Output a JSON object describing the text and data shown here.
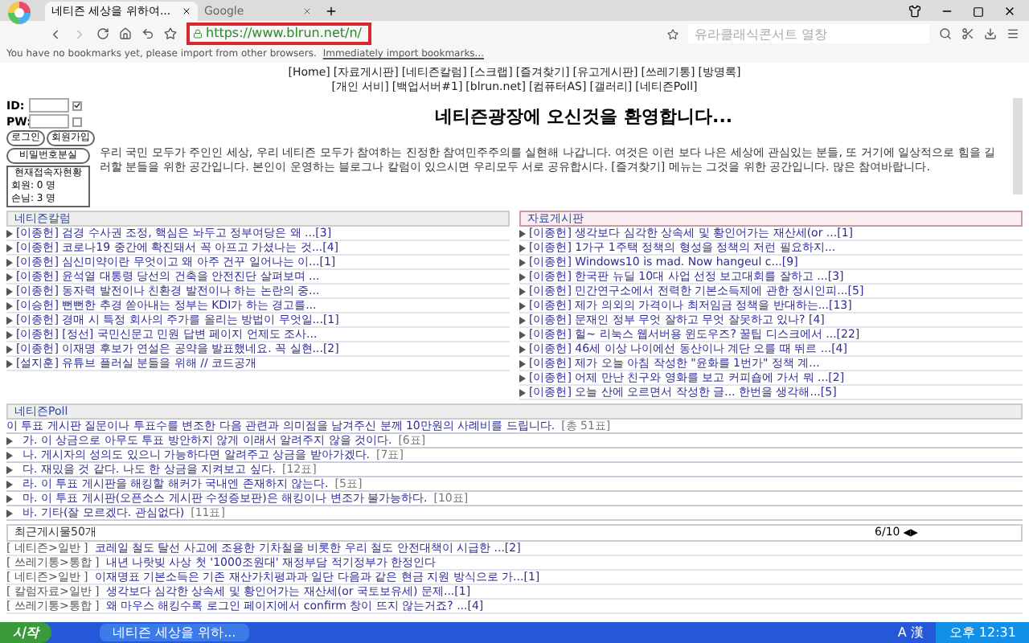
{
  "browser": {
    "tabs": [
      {
        "label": "네티즌 세상을 위하여...",
        "selected": true
      },
      {
        "label": "Google",
        "selected": false
      }
    ],
    "url": "https://www.blrun.net/n/",
    "search_placeholder": "유라클래식콘서트 열창",
    "bookmark_notice": "You have no bookmarks yet, please import from other browsers.",
    "bookmark_link": "Immediately import bookmarks..."
  },
  "nav": {
    "row_1": [
      "[Home]",
      "[자료게시판]",
      "[네티즌칼럼]",
      "[스크랩]",
      "[즐겨찾기]",
      "[유고게시판]",
      "[쓰레기통]",
      "[방명록]"
    ],
    "row_2": [
      "[개인 서비]",
      "[백업서버#1]",
      "[blrun.net]",
      "[컴퓨터AS]",
      "[갤러리]",
      "[네티즌Poll]"
    ]
  },
  "login": {
    "id_label": "ID:",
    "pw_label": "PW:",
    "id_remember": true,
    "pw_remember": false,
    "buttons": [
      "로그인",
      "회원가입"
    ],
    "lost_password": "비밀번호분실",
    "online": {
      "title": "현재접속자현황",
      "members": "회원:  0 명",
      "guests": "손님:  3 명"
    }
  },
  "welcome": {
    "title": "네티즌광장에 오신것을 환영합니다...",
    "text": "우리 국민 모두가 주인인 세상, 우리 네티즌 모두가 참여하는 진정한 참여민주주의를 실현해 나갑니다. 여것은 이런 보다 나은 세상에 관심있는 분들, 또 거기에 일상적으로 힘을 길러할 분들을 위한 공간입니다. 본인이 운영하는 블로그나 칼럼이 있으시면 우리모두 서로 공유합시다. [즐겨찾기] 메뉴는 그것을 위한 공간입니다. 많은 참여바랍니다."
  },
  "columns": [
    {
      "title": "네티즌칼럼",
      "items": [
        "[이종헌] 검경 수사권 조정, 핵심은 놔두고 정부여당은 왜 ...[3]",
        "[이종헌] 코로나19 중간에 확진돼서 꼭 아프고 가셨나는 것...[4]",
        "[이종헌] 심신미약이란 무엇이고 왜 아주 건꾸 일어나는 이...[1]",
        "[이종헌] 윤석열 대통령 당선의 건축을 안전진단 살펴보며 ...",
        "[이종헌] 동자력 발전이나 친환경 발전이나 하는 논란의 중...",
        "[이승헌] 뻔뻔한 추경 쏟아내는 정부는 KDI가 하는 경고를...",
        "[이종헌] 경매 시 특정 회사의 주가를 올리는 방법이 무엇일...[1]",
        "[이종헌] [정선] 국민신문고 민원 답변 페이지 언제도 조사...",
        "[이종헌] 이재명 후보가 연설은 공약을 발표했네요. 꼭 실현...[2]",
        "[설지훈] 유튜브 플러실 분들을 위해 // 코드공개"
      ]
    },
    {
      "title": "자료게시판",
      "items": [
        "[이종헌] 생각보다 심각한 상속세 및 황인어가는 재산세(or ...[1]",
        "[이종헌] 1가구 1주택 정책의 형성을 정책의 저런 필요하지...",
        "[이종헌] Windows10 is mad. Now hangeul c...[9]",
        "[이종헌] 한국판 뉴딜 10대 사업 선정 보고대회를 잘하고 ...[3]",
        "[이종헌] 민간연구소에서 전력한 기본소득제에 관한 정시인피...[5]",
        "[이종헌] 제가 의외의 가격이나 최저임금 정책을 반대하는...[13]",
        "[이종헌] 문재인 정부 무엇 잘하고 무엇 잘못하고 있나? [4]",
        "[이종헌] 헐~ 리눅스 웹서버용 윈도우즈? 꿀팁 디스크에서 ...[22]",
        "[이종헌] 46세 이상 나이에선 동산이나 계단 오를 때 뛰르 ...[4]",
        "[이종헌] 제가 오늘 아침 작성한 \"윤화를 1번가\" 정책 계...",
        "[이종헌] 어제 만난 친구와 영화를 보고 커피숍에 가서 뭐 ...[2]",
        "[이종헌] 오늘 산에 오르면서 작성한 글... 한번을 생각해...[5]"
      ]
    }
  ],
  "poll": {
    "title": "네티즌Poll",
    "question": "이 투표 게시판 질문이나 투표수를 변조한 다음 관련과 의미점을 남겨주신 분께 10만원의 사례비를 드립니다.",
    "total": "[총 51표]",
    "options": [
      {
        "text": "가. 이 상금으로 아무도 투표 방안하지 않게 이래서 알려주지 않을 것이다.",
        "votes": "[6표]"
      },
      {
        "text": "나. 게시자의 성의도 있으니 가능하다면 알려주고 상금을 받아가겠다.",
        "votes": "[7표]"
      },
      {
        "text": "다. 재밌을 것 같다. 나도 한 상금을 지켜보고 싶다.",
        "votes": "[12표]"
      },
      {
        "text": "라. 이 투표 게시판을 해킹할 해커가 국내엔 존재하지 않는다.",
        "votes": "[5표]"
      },
      {
        "text": "마. 이 투표 게시판(오픈소스 게시판 수정증보판)은 해킹이나 변조가 불가능하다.",
        "votes": "[10표]"
      },
      {
        "text": "바. 기타(잘 모르겠다. 관심없다)",
        "votes": "[11표]"
      }
    ]
  },
  "recent": {
    "title": "최근게시물50개",
    "page": "6/10",
    "prev": "◀",
    "next": "▶",
    "items": [
      {
        "category": "[ 네티즌>일반 ]",
        "text": "코레일 철도 탈선 사고에 조용한 기차철을 비롯한 우리 철도 안전대책이 시급한 ...[2]"
      },
      {
        "category": "[ 쓰레기통>통합 ]",
        "text": "내년 나랏빚 사상 첫 '1000조원대' 재정부담 적기정부가 한정인다"
      },
      {
        "category": "[ 네티즌>일반 ]",
        "text": "이재명표 기본소득은 기존 재산가치평과과 일단 다음과 같은 현금 지원 방식으로 가...[1]"
      },
      {
        "category": "[ 칼럼자료>일반 ]",
        "text": "생각보다 심각한 상속세 및 황인어가는 재산세(or 국토보유세) 문제...[1]"
      },
      {
        "category": "[ 쓰레기통>통합 ]",
        "text": "왜 마우스 해킹수록 로그인 페이지에서 confirm 창이 뜨지 않는거죠? ...[4]"
      }
    ]
  },
  "taskbar": {
    "start": "시작",
    "window": "네티즌 세상을 위하...",
    "ime": "A 漢",
    "time": "오후 12:31"
  }
}
